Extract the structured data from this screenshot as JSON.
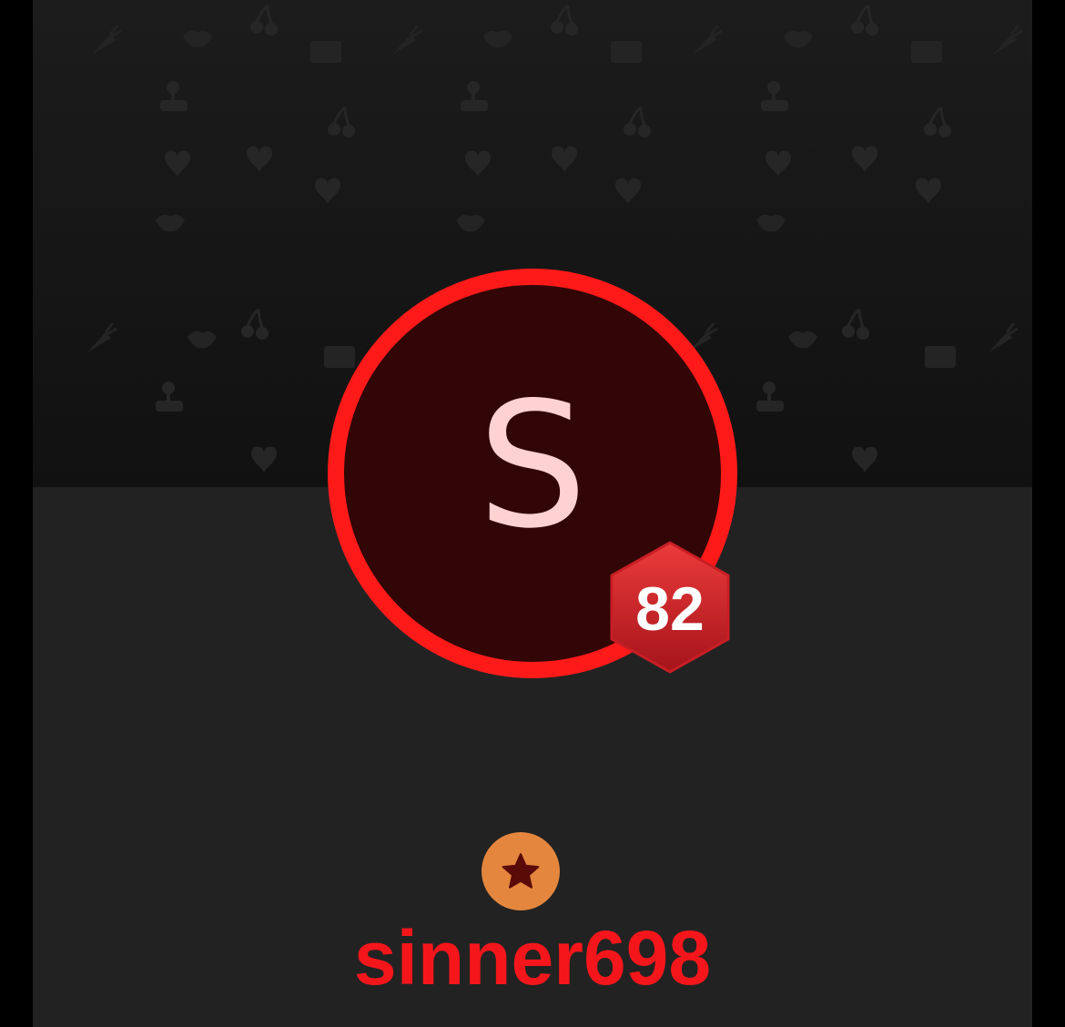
{
  "profile": {
    "initial": "S",
    "level": "82",
    "username": "sinner698",
    "rank_icon": "star-icon"
  },
  "colors": {
    "accent": "#ff1a1a",
    "username": "#f5161b",
    "avatar_bg": "#320606",
    "avatar_text": "#ffd2d2",
    "rank_badge": "#e5863e",
    "rank_star": "#5a0b08",
    "page_bg": "#222222",
    "cover_bg": "#151515"
  },
  "cover": {
    "pattern_icons": [
      "cherry-icon",
      "lips-icon",
      "heart-icon",
      "envelope-icon",
      "carrot-icon",
      "joystick-icon"
    ]
  }
}
